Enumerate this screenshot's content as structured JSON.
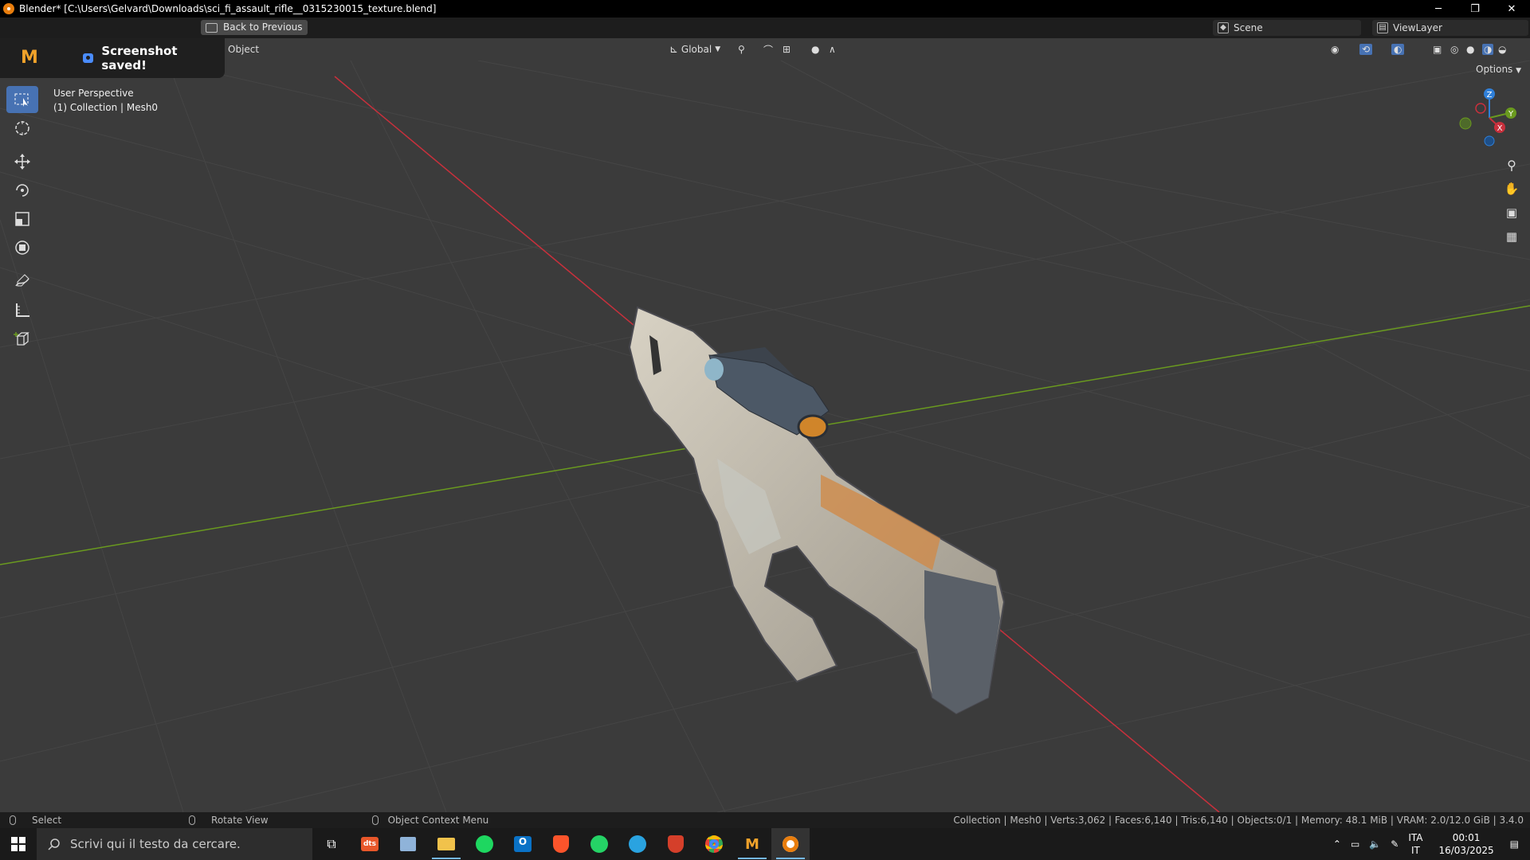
{
  "window": {
    "title": "Blender* [C:\\Users\\Gelvard\\Downloads\\sci_fi_assault_rifle__0315230015_texture.blend]",
    "min": "─",
    "restore": "❐",
    "close": "✕"
  },
  "header": {
    "back_label": "Back to Previous",
    "scene_label": "Scene",
    "viewlayer_label": "ViewLayer"
  },
  "toast": {
    "logo": "M",
    "message": "Screenshot saved!"
  },
  "viewport_header": {
    "object_menu": "Object",
    "orientation": "Global",
    "options": "Options"
  },
  "overlay": {
    "perspective": "User Perspective",
    "collection": "(1) Collection | Mesh0"
  },
  "gizmo": {
    "z": "Z",
    "y": "Y",
    "x": "X"
  },
  "status": {
    "select": "Select",
    "rotate": "Rotate View",
    "context": "Object Context Menu",
    "stats": "Collection | Mesh0 | Verts:3,062 | Faces:6,140 | Tris:6,140 | Objects:0/1 | Memory: 48.1 MiB | VRAM: 2.0/12.0 GiB | 3.4.0"
  },
  "taskbar": {
    "search_placeholder": "Scrivi qui il testo da cercare.",
    "lang_top": "ITA",
    "lang_bottom": "IT",
    "time": "00:01",
    "date": "16/03/2025"
  },
  "colors": {
    "accent": "#4772b3",
    "x_axis": "#c8303c",
    "y_axis": "#6a9a1f",
    "z_axis": "#2f7fd8",
    "viewport_bg": "#3b3b3b"
  },
  "icons": [
    "blender-icon",
    "move-icon",
    "rotate-icon",
    "scale-icon",
    "transform-icon",
    "annotate-icon",
    "measure-icon",
    "add-cube-icon",
    "cursor-icon",
    "select-box-icon",
    "zoom-icon",
    "hand-icon",
    "camera-icon",
    "grid-icon",
    "windows-icon",
    "search-icon"
  ]
}
